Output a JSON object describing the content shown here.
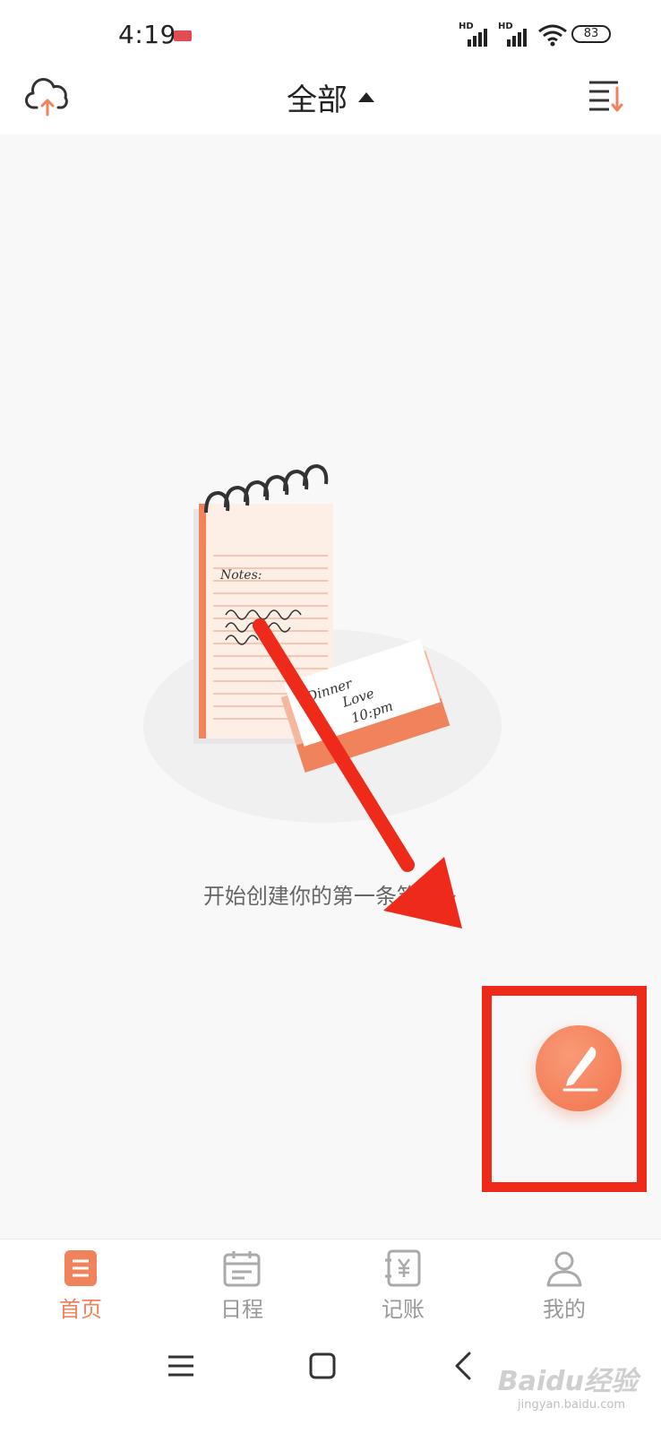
{
  "status_bar": {
    "time": "4:19",
    "signal1_label": "HD",
    "signal2_label": "HD",
    "battery": "83"
  },
  "header": {
    "title": "全部",
    "cloud_icon": "cloud-upload-icon",
    "sort_icon": "sort-icon"
  },
  "main": {
    "empty_message": "开始创建你的第一条笔记~",
    "illustration": "notebook-illustration",
    "note_text": "Notes:",
    "card_text": [
      "Dinner",
      "Love",
      "10:pm"
    ]
  },
  "fab": {
    "icon": "pen-icon"
  },
  "tabs": [
    {
      "label": "首页",
      "icon": "home-notes-icon",
      "active": true
    },
    {
      "label": "日程",
      "icon": "calendar-icon",
      "active": false
    },
    {
      "label": "记账",
      "icon": "ledger-icon",
      "active": false
    },
    {
      "label": "我的",
      "icon": "profile-icon",
      "active": false
    }
  ],
  "system_nav": {
    "menu_icon": "menu-icon",
    "home_icon": "home-square-icon",
    "back_icon": "back-icon"
  },
  "watermark": {
    "text": "Baidu经验",
    "sub": "jingyan.baidu.com"
  },
  "colors": {
    "accent": "#f0825c",
    "annotation": "#ee2a1a",
    "inactive": "#999999"
  }
}
